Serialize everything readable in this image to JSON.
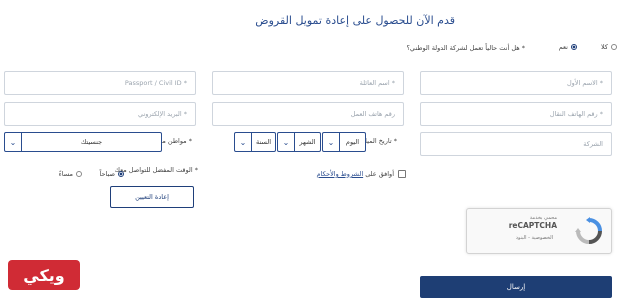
{
  "form": {
    "title": "قدم الآن للحصول على إعادة تمويل القروض",
    "question_label": "هل أنت حالياً تعمل لشركة الدولة الوطني؟ *",
    "radio_yes": "نعم",
    "radio_no": "كلا",
    "first_name_placeholder": "الاسم الأول *",
    "family_name_placeholder": "اسم العائلة *",
    "civil_id_placeholder": "Passport / Civil ID *",
    "mobile_placeholder": "رقم الهاتف النقال *",
    "work_phone_placeholder": "رقم هاتف العمل",
    "email_placeholder": "البريد الإلكتروني *",
    "company_placeholder": "الشركة",
    "dob_label": "تاريخ الميلاد *",
    "dob_day": "اليوم",
    "dob_month": "الشهر",
    "dob_year": "السنة",
    "nationality_label": "مواطن من *",
    "nationality_value": "جنسيتك",
    "terms_prefix": "أوافق على",
    "terms_link": "الشروط والأحكام",
    "contact_time_label": "الوقت المفضل للتواصل معك *",
    "contact_morning": "صباحاً",
    "contact_evening": "مساءً",
    "reset_button": "إعادة التعيين",
    "submit_button": "إرسال"
  },
  "captcha": {
    "brand": "reCAPTCHA",
    "subtitle": "محمي بخدمة",
    "privacy": "الخصوصية - البنود"
  },
  "logo": {
    "text": "ويكي"
  },
  "colors": {
    "primary": "#1e3e74",
    "title": "#2a4d8f",
    "logo_bg": "#d02b35"
  }
}
